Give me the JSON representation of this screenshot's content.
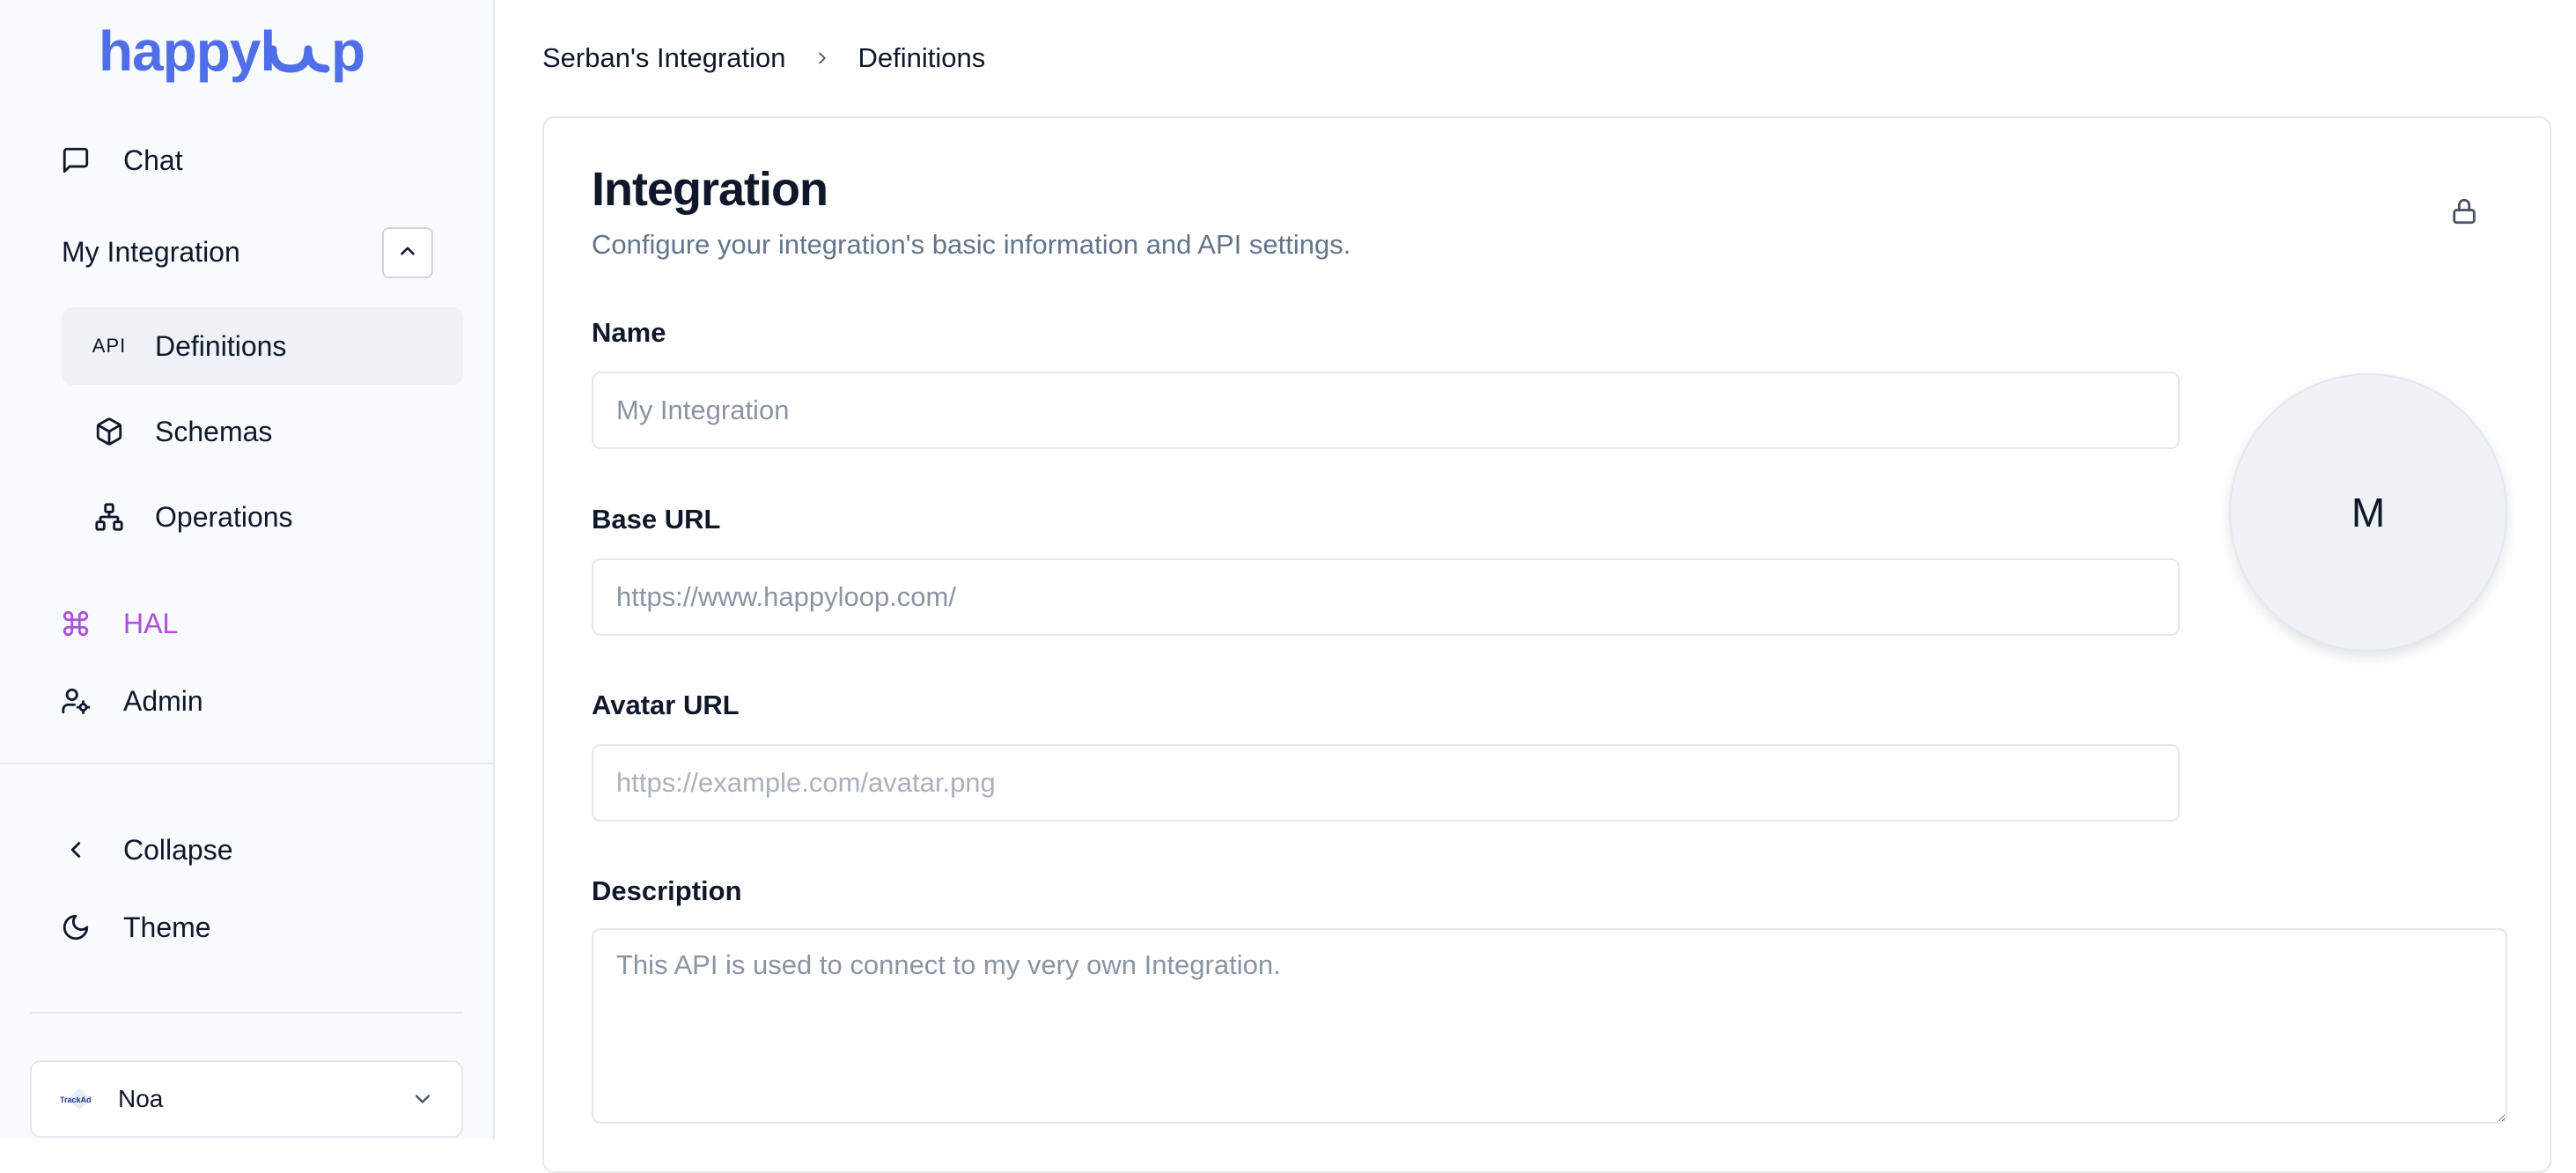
{
  "brand": {
    "name": "happyloop",
    "color": "#4f6ee8"
  },
  "sidebar": {
    "chat_label": "Chat",
    "integration_group": "My Integration",
    "sub_items": [
      {
        "label": "Definitions",
        "icon": "api-icon",
        "icon_text": "API",
        "active": true
      },
      {
        "label": "Schemas",
        "icon": "cube-icon"
      },
      {
        "label": "Operations",
        "icon": "network-icon"
      }
    ],
    "hal_label": "HAL",
    "hal_color": "#b04fd6",
    "admin_label": "Admin",
    "collapse_label": "Collapse",
    "theme_label": "Theme",
    "user": {
      "name": "Noa",
      "logo_text": "TrackAd"
    }
  },
  "breadcrumb": {
    "parent": "Serban's Integration",
    "current": "Definitions"
  },
  "card": {
    "title": "Integration",
    "subtitle": "Configure your integration's basic information and API settings.",
    "fields": {
      "name": {
        "label": "Name",
        "placeholder": "My Integration"
      },
      "base_url": {
        "label": "Base URL",
        "placeholder": "https://www.happyloop.com/"
      },
      "avatar_url": {
        "label": "Avatar URL",
        "placeholder": "https://example.com/avatar.png"
      },
      "description": {
        "label": "Description",
        "placeholder": "This API is used to connect to my very own Integration."
      }
    },
    "avatar_initial": "M"
  }
}
